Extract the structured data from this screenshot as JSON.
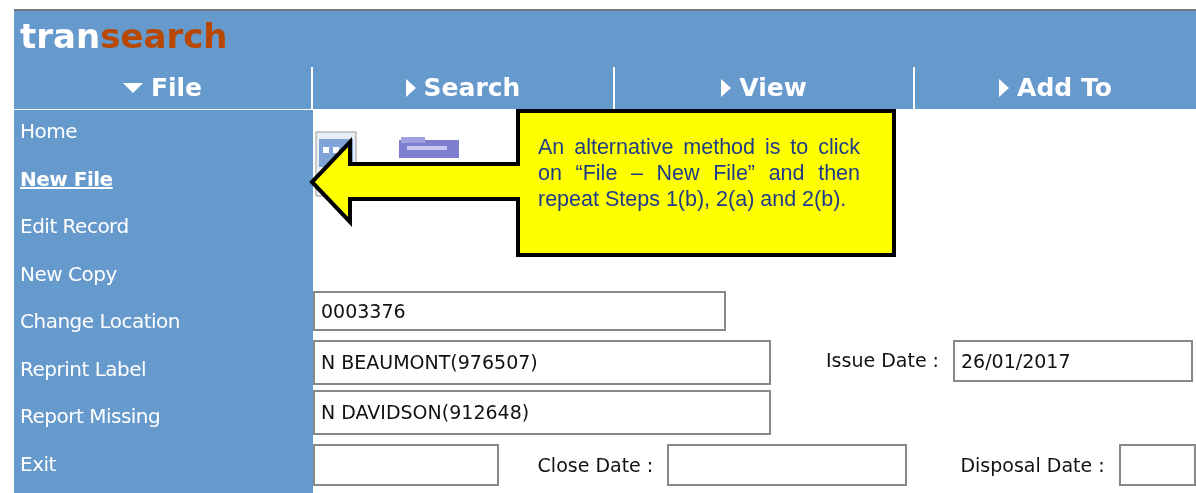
{
  "logo": [
    "tran",
    "search"
  ],
  "tabs": [
    {
      "label": "File",
      "expanded": true
    },
    {
      "label": "Search",
      "expanded": false
    },
    {
      "label": "View",
      "expanded": false
    },
    {
      "label": "Add To",
      "expanded": false
    }
  ],
  "file_menu": [
    {
      "label": "Home",
      "selected": false
    },
    {
      "label": "New File",
      "selected": true
    },
    {
      "label": "Edit Record",
      "selected": false
    },
    {
      "label": "New Copy",
      "selected": false
    },
    {
      "label": "Change Location",
      "selected": false
    },
    {
      "label": "Reprint Label",
      "selected": false
    },
    {
      "label": "Report Missing",
      "selected": false
    },
    {
      "label": "Exit",
      "selected": false
    }
  ],
  "callout": "An alternative method is to click on “File – New File” and then repeat Steps 1(b), 2(a) and 2(b).",
  "form": {
    "field_1": "0003376",
    "field_2": "N BEAUMONT(976507)",
    "issue_date_label": "Issue Date :",
    "issue_date": "26/01/2017",
    "field_3": "N DAVIDSON(912648)",
    "close_date_label": "Close Date :",
    "disposal_date_label": "Disposal Date :"
  }
}
